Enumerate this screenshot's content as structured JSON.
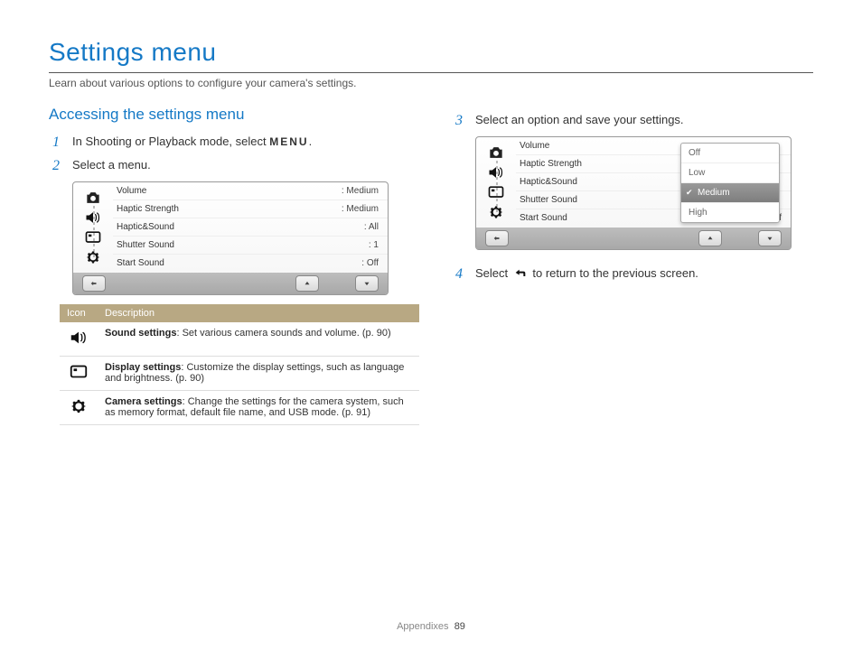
{
  "header": {
    "title": "Settings menu",
    "subtitle": "Learn about various options to configure your camera's settings."
  },
  "left": {
    "heading": "Accessing the settings menu",
    "step1_pre": "In Shooting or Playback mode, select ",
    "step1_menu": "MENU",
    "step1_post": ".",
    "step2": "Select a menu.",
    "panel": {
      "rows": [
        {
          "label": "Volume",
          "value": ": Medium"
        },
        {
          "label": "Haptic Strength",
          "value": ": Medium"
        },
        {
          "label": "Haptic&Sound",
          "value": ": All"
        },
        {
          "label": "Shutter Sound",
          "value": ": 1"
        },
        {
          "label": "Start Sound",
          "value": ": Off"
        }
      ]
    },
    "table": {
      "h1": "Icon",
      "h2": "Description",
      "r1_b": "Sound settings",
      "r1": ": Set various camera sounds and volume. (p. 90)",
      "r2_b": "Display settings",
      "r2": ": Customize the display settings, such as language and brightness. (p. 90)",
      "r3_b": "Camera settings",
      "r3": ": Change the settings for the camera system, such as memory format, default file name, and USB mode. (p. 91)"
    }
  },
  "right": {
    "step3": "Select an option and save your settings.",
    "panel": {
      "rows": [
        {
          "label": "Volume",
          "value": ""
        },
        {
          "label": "Haptic Strength",
          "value": ""
        },
        {
          "label": "Haptic&Sound",
          "value": ""
        },
        {
          "label": "Shutter Sound",
          "value": ""
        },
        {
          "label": "Start Sound",
          "value": ": Off"
        }
      ],
      "popup": [
        "Off",
        "Low",
        "Medium",
        "High"
      ],
      "selected": "Medium"
    },
    "step4_pre": "Select ",
    "step4_post": " to return to the previous screen."
  },
  "footer": {
    "section": "Appendixes",
    "page": "89"
  }
}
